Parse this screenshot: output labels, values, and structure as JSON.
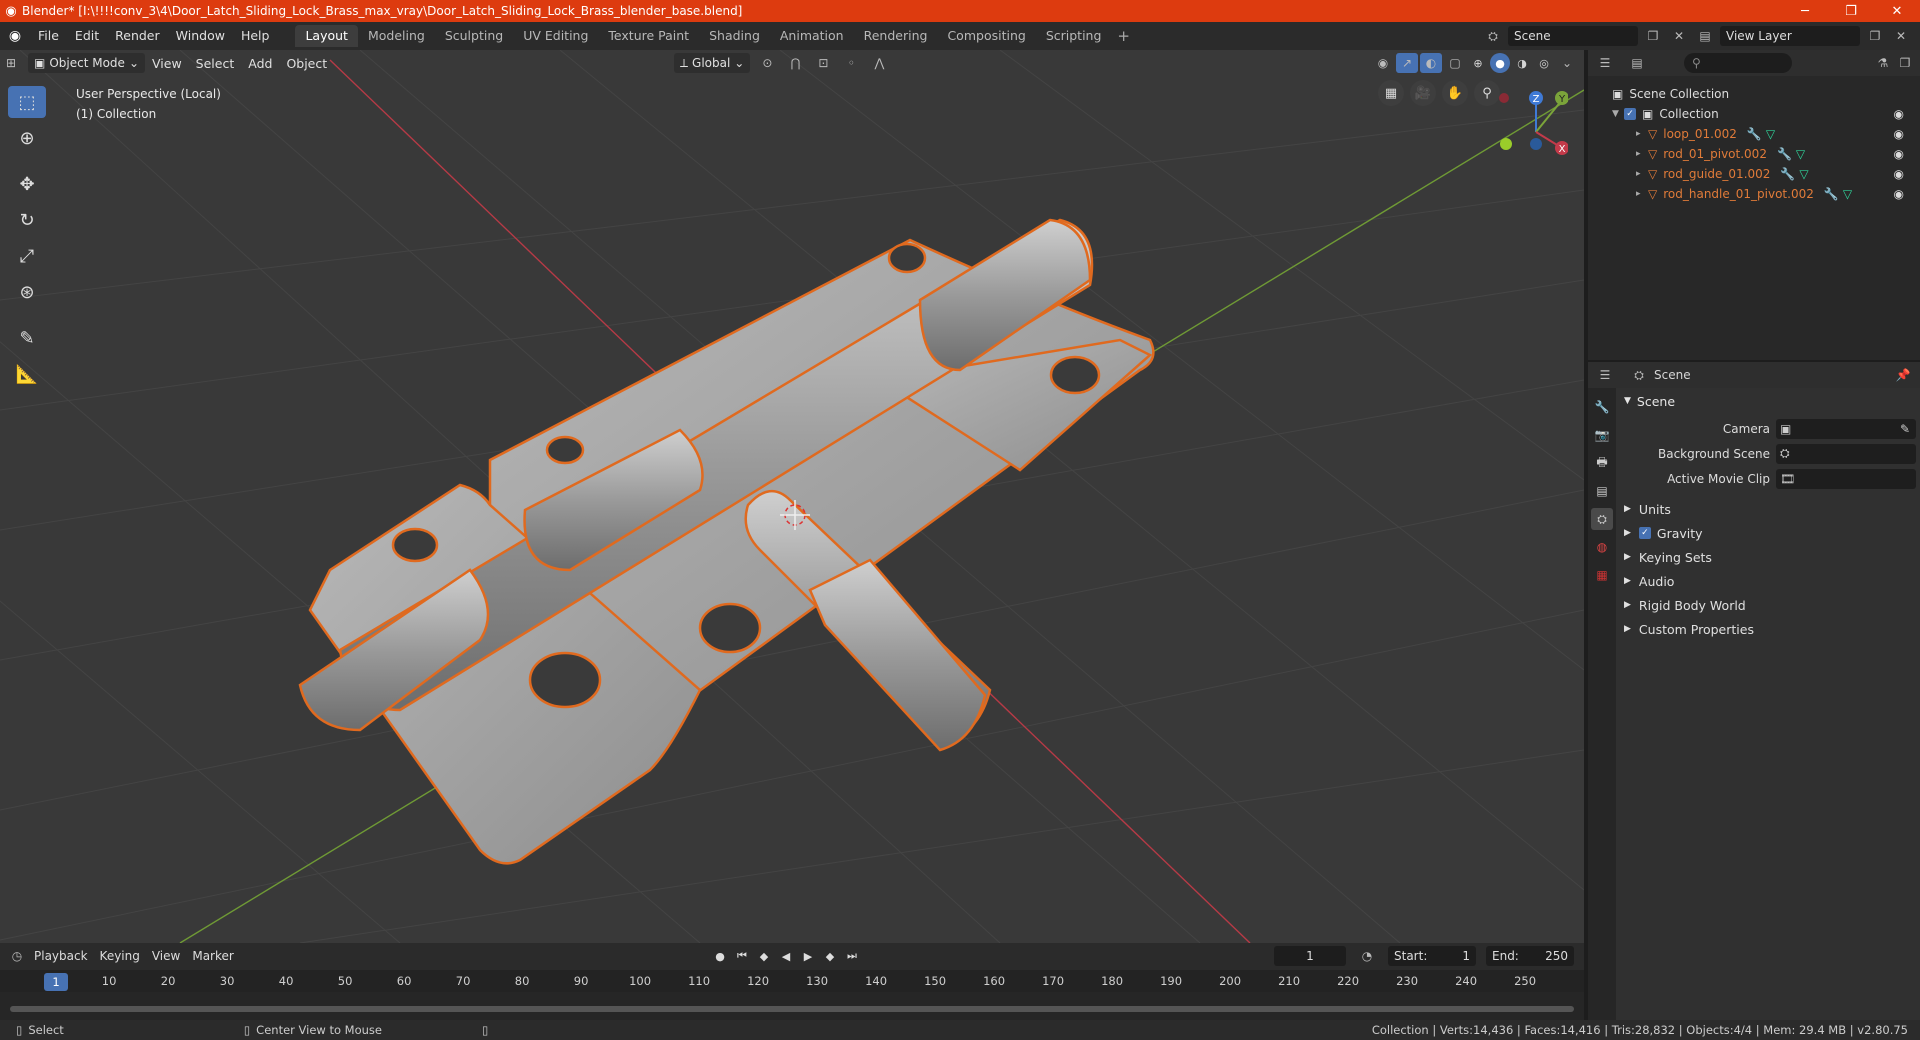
{
  "window": {
    "title": "Blender* [I:\\!!!!conv_3\\4\\Door_Latch_Sliding_Lock_Brass_max_vray\\Door_Latch_Sliding_Lock_Brass_blender_base.blend]",
    "minimize": "─",
    "maximize": "❐",
    "close": "✕"
  },
  "menubar": {
    "menus": [
      "File",
      "Edit",
      "Render",
      "Window",
      "Help"
    ],
    "workspaces": [
      "Layout",
      "Modeling",
      "Sculpting",
      "UV Editing",
      "Texture Paint",
      "Shading",
      "Animation",
      "Rendering",
      "Compositing",
      "Scripting"
    ],
    "active_workspace": "Layout",
    "add_tab": "+",
    "scene": "Scene",
    "view_layer": "View Layer"
  },
  "viewport": {
    "mode": "Object Mode",
    "menus": [
      "View",
      "Select",
      "Add",
      "Object"
    ],
    "orientation": "Global",
    "info_line1": "User Perspective (Local)",
    "info_line2": "(1) Collection",
    "axes": {
      "z": "Z",
      "y": "Y",
      "x": "X"
    },
    "colors": {
      "accent": "#4772b3",
      "selection": "#e06a1f",
      "x_axis": "#c33a4a",
      "y_axis": "#7ba43a",
      "z_axis": "#3f7ad6"
    }
  },
  "timeline": {
    "menus": [
      "Playback",
      "Keying",
      "View",
      "Marker"
    ],
    "current_frame": "1",
    "start_label": "Start:",
    "start": "1",
    "end_label": "End:",
    "end": "250",
    "ticks": [
      "10",
      "20",
      "30",
      "40",
      "50",
      "60",
      "70",
      "80",
      "90",
      "100",
      "110",
      "120",
      "130",
      "140",
      "150",
      "160",
      "170",
      "180",
      "190",
      "200",
      "210",
      "220",
      "230",
      "240",
      "250"
    ]
  },
  "statusbar": {
    "select": "Select",
    "center_view": "Center View to Mouse",
    "stats": "Collection | Verts:14,436 | Faces:14,416 | Tris:28,832 | Objects:4/4 | Mem: 29.4 MB | v2.80.75"
  },
  "outliner": {
    "search_placeholder": "",
    "scene_collection": "Scene Collection",
    "collection": "Collection",
    "objects": [
      "loop_01.002",
      "rod_01_pivot.002",
      "rod_guide_01.002",
      "rod_handle_01_pivot.002"
    ]
  },
  "properties": {
    "context": "Scene",
    "panel": "Scene",
    "camera_label": "Camera",
    "bg_scene_label": "Background Scene",
    "movie_clip_label": "Active Movie Clip",
    "sections": [
      "Units",
      "Gravity",
      "Keying Sets",
      "Audio",
      "Rigid Body World",
      "Custom Properties"
    ],
    "gravity_checked": true
  }
}
